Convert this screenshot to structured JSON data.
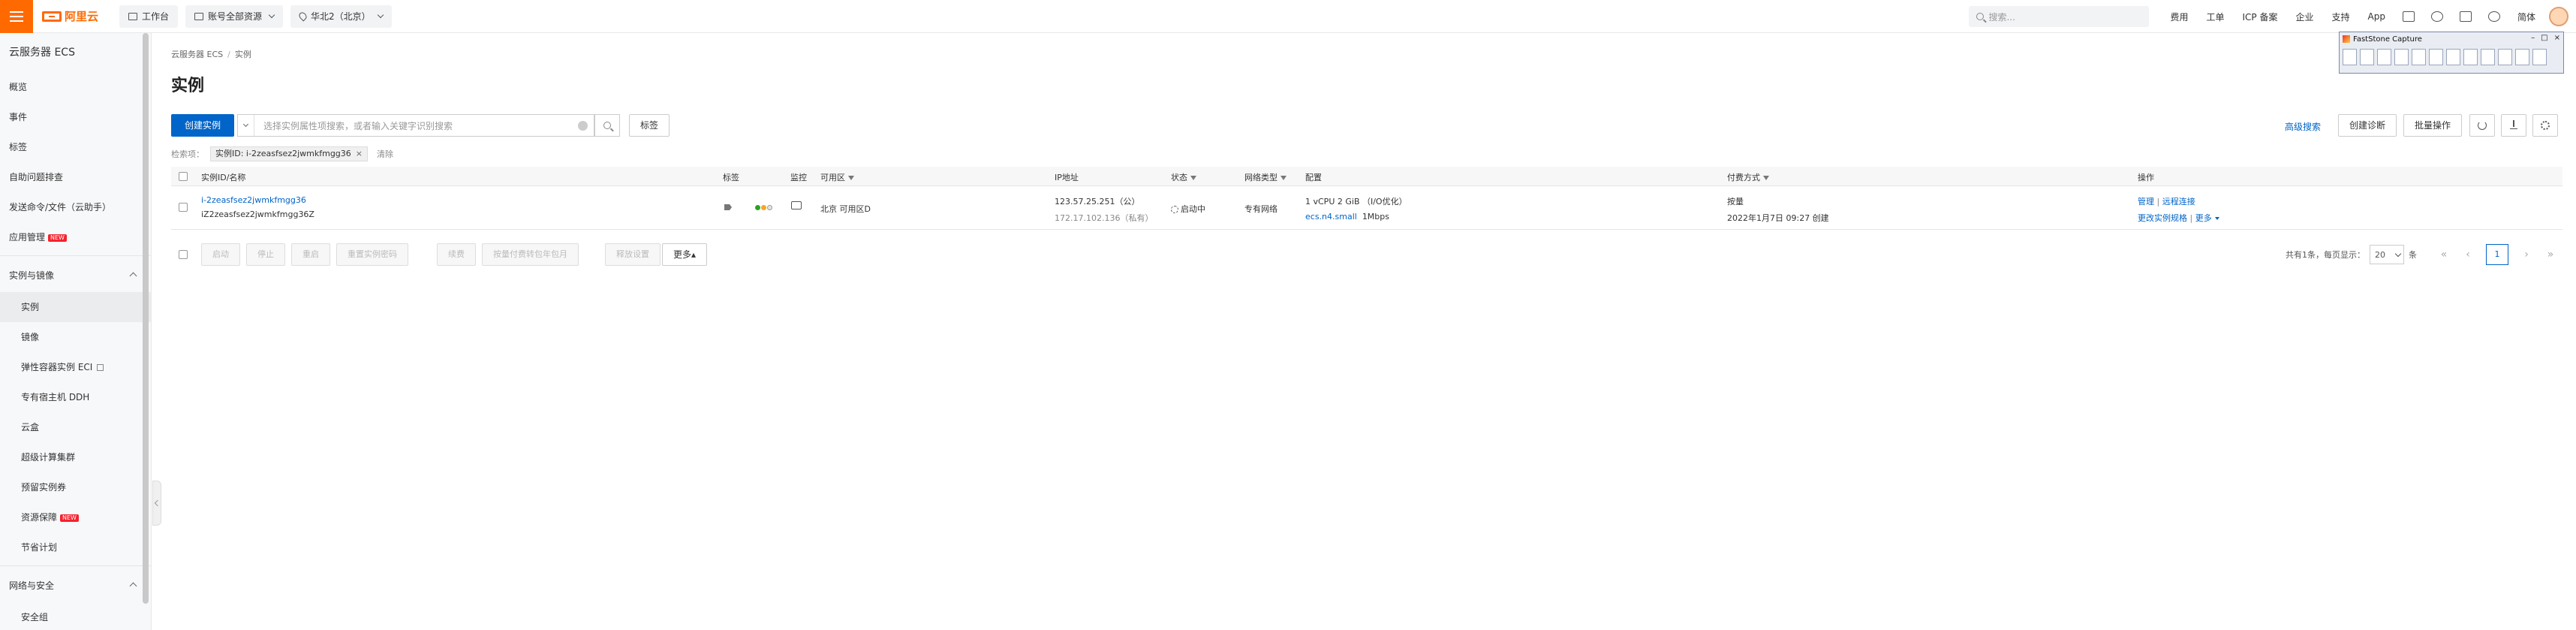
{
  "topbar": {
    "brand": "阿里云",
    "workbench": "工作台",
    "account_resources": "账号全部资源",
    "region": "华北2（北京）",
    "search_placeholder": "搜索...",
    "links": [
      "费用",
      "工单",
      "ICP 备案",
      "企业",
      "支持",
      "App"
    ],
    "lang": "简体"
  },
  "sidebar": {
    "title": "云服务器 ECS",
    "top_items": [
      "概览",
      "事件",
      "标签",
      "自助问题排查",
      "发送命令/文件（云助手）",
      "应用管理"
    ],
    "new_badge": "NEW",
    "group1": "实例与镜像",
    "group1_items": [
      "实例",
      "镜像",
      "弹性容器实例 ECI",
      "专有宿主机 DDH",
      "云盒",
      "超级计算集群",
      "预留实例券",
      "资源保障",
      "节省计划"
    ],
    "group2": "网络与安全",
    "group2_items": [
      "安全组"
    ]
  },
  "main": {
    "breadcrumb": [
      "云服务器 ECS",
      "实例"
    ],
    "breadcrumb_sep": "/",
    "title": "实例",
    "create_button": "创建实例",
    "filter_placeholder": "选择实例属性项搜索，或者输入关键字识别搜索",
    "tag_button": "标签",
    "advanced_search": "高级搜索",
    "create_diagnosis": "创建诊断",
    "batch_ops": "批量操作",
    "filter_label": "检索项：",
    "filter_tag": "实例ID: i-2zeasfsez2jwmkfmgg36",
    "filter_clear": "清除"
  },
  "table": {
    "headers": {
      "id": "实例ID/名称",
      "tag": "标签",
      "monitor": "监控",
      "zone": "可用区",
      "ip": "IP地址",
      "status": "状态",
      "network": "网络类型",
      "config": "配置",
      "billing": "付费方式",
      "actions": "操作"
    },
    "rows": [
      {
        "id_link": "i-2zeasfsez2jwmkfmgg36",
        "name": "iZ2zeasfsez2jwmkfmgg36Z",
        "zone": "北京 可用区D",
        "ip_public": "123.57.25.251（公）",
        "ip_private": "172.17.102.136（私有）",
        "status": "启动中",
        "network": "专有网络",
        "config_line1": "1 vCPU 2 GiB （I/O优化）",
        "config_type": "ecs.n4.small",
        "config_bw": "1Mbps",
        "billing_type": "按量",
        "billing_time": "2022年1月7日 09:27 创建",
        "action_manage": "管理",
        "action_sep": "|",
        "action_remote": "远程连接",
        "action_change": "更改实例规格",
        "action_more": "更多"
      }
    ]
  },
  "bottom": {
    "buttons": [
      "启动",
      "停止",
      "重启",
      "重置实例密码",
      "续费",
      "按量付费转包年包月",
      "释放设置"
    ],
    "more": "更多▴",
    "pager_text_pre": "共有1条，每页显示：",
    "page_size": "20",
    "pager_text_post": "条",
    "first": "«",
    "prev": "‹",
    "current": "1",
    "next": "›",
    "last": "»"
  },
  "faststone": {
    "title": "FastStone Capture",
    "controls": [
      "–",
      "□",
      "×"
    ]
  },
  "colors": {
    "brand_orange": "#ff6a00",
    "primary_blue": "#0064c8"
  }
}
